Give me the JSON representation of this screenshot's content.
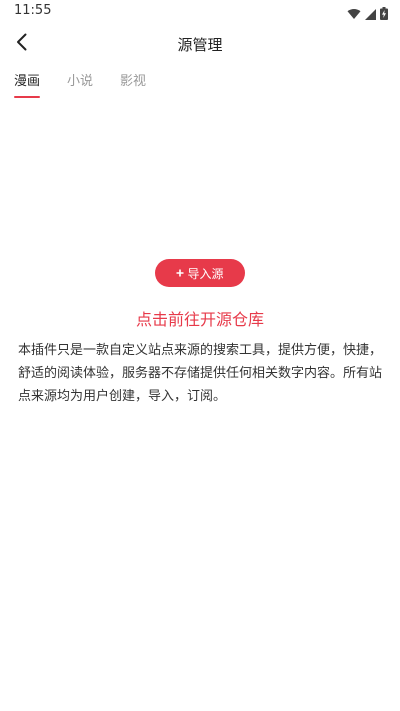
{
  "status_bar": {
    "time": "11:55",
    "icons": [
      "wifi-icon",
      "signal-icon",
      "battery-charging-icon"
    ]
  },
  "app_bar": {
    "back_icon": "chevron-left-icon",
    "title": "源管理"
  },
  "tabs": [
    {
      "label": "漫画",
      "active": true
    },
    {
      "label": "小说",
      "active": false
    },
    {
      "label": "影视",
      "active": false
    }
  ],
  "main": {
    "import_button": {
      "icon": "plus-icon",
      "label": "导入源"
    },
    "open_repo_link": "点击前往开源仓库",
    "disclaimer": "本插件只是一款自定义站点来源的搜索工具，提供方便，快捷，舒适的阅读体验，服务器不存储提供任何相关数字内容。所有站点来源均为用户创建，导入，订阅。"
  },
  "colors": {
    "accent": "#e73a4a",
    "text_primary": "#222222",
    "text_inactive": "#999999",
    "background": "#ffffff"
  }
}
